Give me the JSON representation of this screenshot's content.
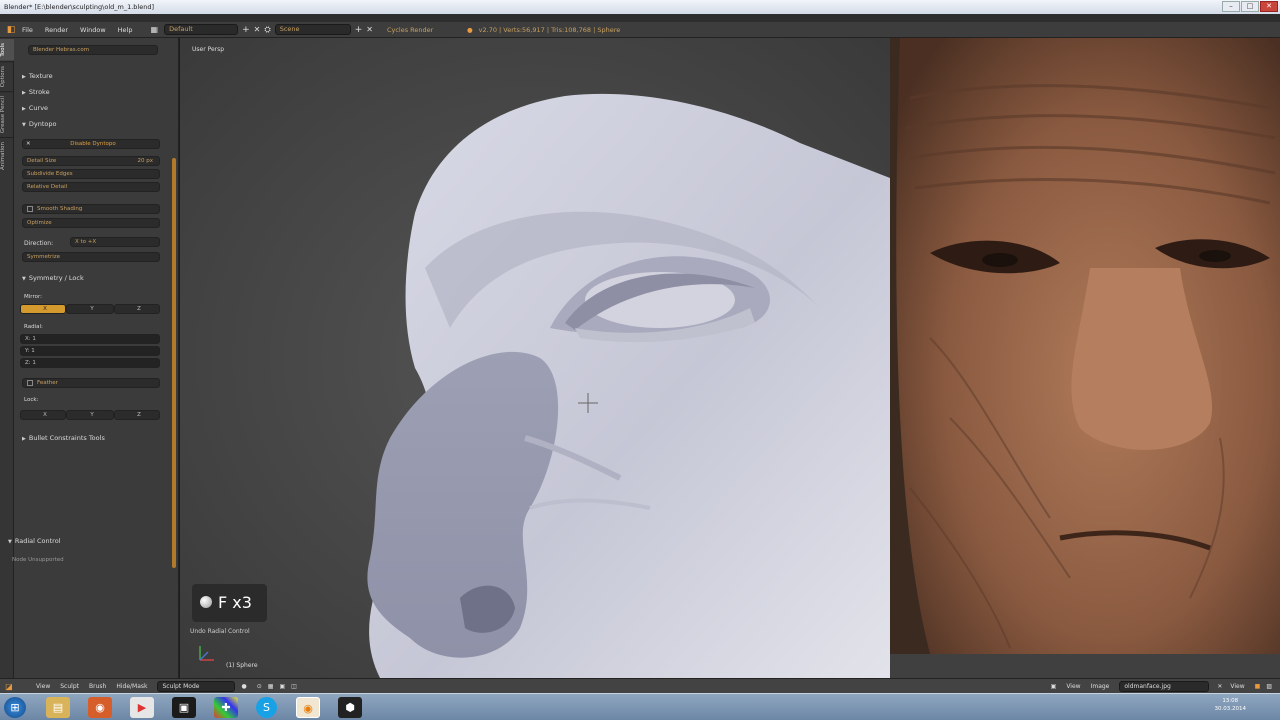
{
  "titlebar": {
    "title": "Blender* [E:\\blender\\sculpting\\old_m_1.blend]"
  },
  "info": {
    "menus": [
      "File",
      "Render",
      "Window",
      "Help"
    ],
    "layout": "Default",
    "scene": "Scene",
    "engine": "Cycles Render",
    "stats": "v2.70 | Verts:56,917 | Tris:108,768 | Sphere"
  },
  "shelf": {
    "tabs": [
      "Tools",
      "Options",
      "Grease Pencil",
      "Animation"
    ],
    "top_box": "Blender Hebras.com",
    "panels": [
      "Texture",
      "Stroke",
      "Curve",
      "Dyntopo"
    ],
    "dyntopo_button": "Disable Dyntopo",
    "detail_size": "Detail Size",
    "detail_size_value": "20 px",
    "subdivide": "Subdivide Edges",
    "relative_detail": "Relative Detail",
    "smooth_shading": "Smooth Shading",
    "optimize": "Optimize",
    "direction_label": "Direction:",
    "direction_value": "X to +X",
    "symmetrize": "Symmetrize",
    "symmetry_panel": "Symmetry / Lock",
    "mirror_label": "Mirror:",
    "axes": [
      "X",
      "Y",
      "Z"
    ],
    "radial_label": "Radial:",
    "radial_rows": [
      "X: 1",
      "Y: 1",
      "Z: 1"
    ],
    "feather": "Feather",
    "lock_label": "Lock:",
    "bullet": "Bullet Constraints Tools",
    "radial_control": "Radial Control",
    "radial_unsupported": "Node Unsupported"
  },
  "viewport": {
    "label": "User Persp",
    "object": "(1) Sphere",
    "key_display": "F x3",
    "operator": "Undo Radial Control"
  },
  "bottom": {
    "menus": [
      "View",
      "Sculpt",
      "Brush",
      "Hide/Mask"
    ],
    "mode": "Sculpt Mode",
    "image_menus": [
      "View",
      "Image"
    ],
    "image_name": "oldmanface.jpg",
    "image_view": "View"
  },
  "taskbar": {
    "time": "13:08",
    "date": "30.03.2014"
  },
  "colors": {
    "accent": "#d49a2e",
    "header": "#3d3d3d",
    "panel": "#3b3b3b"
  }
}
